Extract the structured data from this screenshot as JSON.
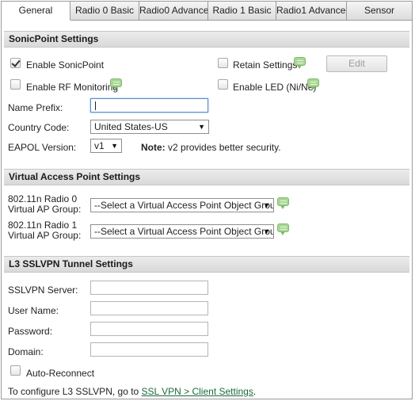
{
  "tabs": [
    {
      "label": "General",
      "active": true
    },
    {
      "label": "Radio 0 Basic"
    },
    {
      "label": "Radio0 Advanced"
    },
    {
      "label": "Radio 1 Basic"
    },
    {
      "label": "Radio1 Advanced"
    },
    {
      "label": "Sensor"
    }
  ],
  "sonicpoint": {
    "title": "SonicPoint Settings",
    "enable_sonicpoint": {
      "label": "Enable SonicPoint",
      "checked": true
    },
    "enable_rf_monitoring": {
      "label": "Enable RF Monitoring",
      "checked": false
    },
    "retain_settings": {
      "label": "Retain Settings",
      "checked": false
    },
    "enable_led": {
      "label": "Enable LED (Ni/Ne)",
      "checked": false
    },
    "edit_button": "Edit",
    "name_prefix": {
      "label": "Name Prefix:",
      "value": ""
    },
    "country_code": {
      "label": "Country Code:",
      "selected": "United States-US"
    },
    "eapol_version": {
      "label": "EAPOL Version:",
      "selected": "v1"
    },
    "note_label": "Note:",
    "note_text": "v2 provides better security."
  },
  "vap": {
    "title": "Virtual Access Point Settings",
    "radio0_label_line1": "802.11n Radio 0",
    "radio0_label_line2": "Virtual AP Group:",
    "radio0_selected": "--Select a Virtual Access Point Object Group--",
    "radio1_label_line1": "802.11n Radio 1",
    "radio1_label_line2": "Virtual AP Group:",
    "radio1_selected": "--Select a Virtual Access Point Object Group--"
  },
  "sslvpn": {
    "title": "L3 SSLVPN Tunnel Settings",
    "server": {
      "label": "SSLVPN Server:",
      "value": ""
    },
    "username": {
      "label": "User Name:",
      "value": ""
    },
    "password": {
      "label": "Password:",
      "value": ""
    },
    "domain": {
      "label": "Domain:",
      "value": ""
    },
    "auto_reconnect": {
      "label": "Auto-Reconnect",
      "checked": false
    },
    "config_text": "To configure L3 SSLVPN, go to ",
    "config_link": "SSL VPN > Client Settings",
    "config_suffix": "."
  },
  "colors": {
    "link": "#1b6a3a",
    "bubble": "#a9d796",
    "focus_border": "#5a8fd0"
  }
}
